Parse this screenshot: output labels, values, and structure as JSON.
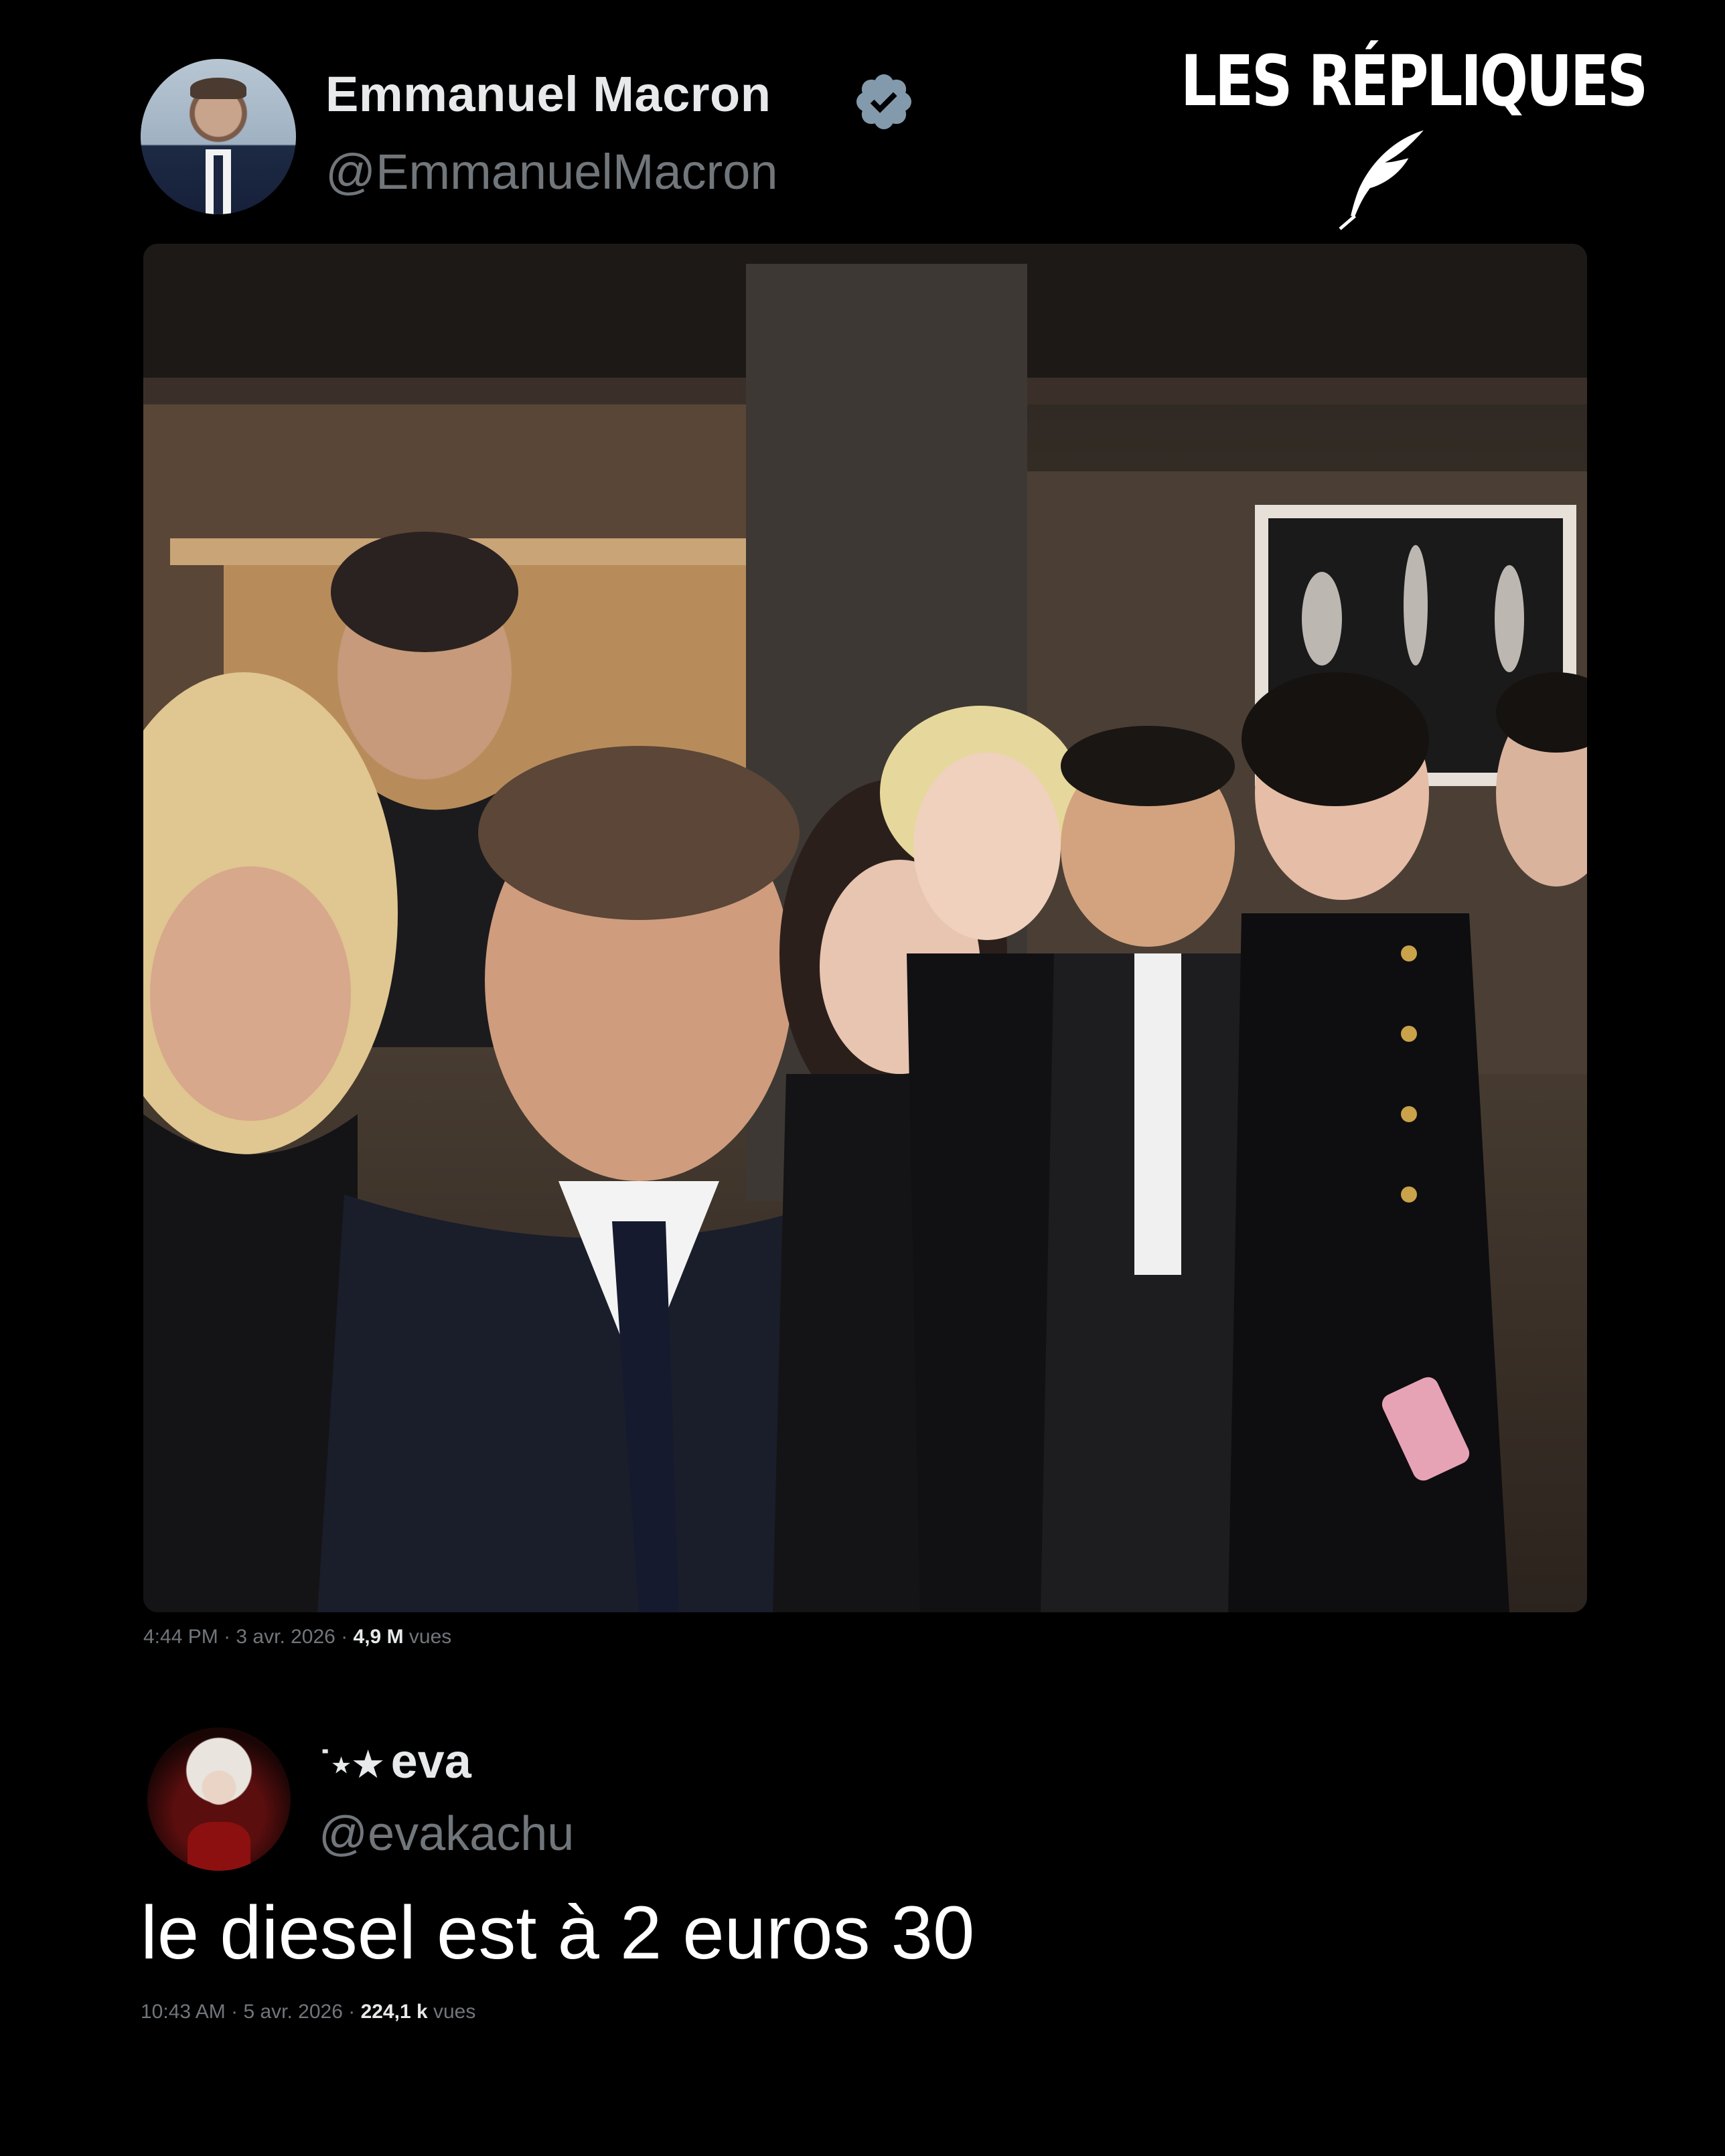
{
  "tweet": {
    "author": {
      "display_name": "Emmanuel Macron",
      "handle": "@EmmanuelMacron",
      "verified": true,
      "verified_icon": "verified-badge-icon"
    },
    "meta": {
      "time": "4:44 PM",
      "sep1": " · ",
      "date": "3 avr. 2026",
      "sep2": " · ",
      "views_count": "4,9 M",
      "views_label": " vues"
    }
  },
  "branding": {
    "title": "LES RÉPLIQUES",
    "icon": "quill-icon"
  },
  "reply": {
    "author": {
      "stars": "˙⋆★",
      "display_name": "eva",
      "handle": "@evakachu"
    },
    "text": "le diesel est à 2 euros 30",
    "meta": {
      "time": "10:43 AM",
      "sep1": " · ",
      "date": "5 avr. 2026",
      "sep2": " · ",
      "views_count": "224,1 k",
      "views_label": " vues"
    }
  },
  "colors": {
    "background": "#000000",
    "primary_text": "#e7e9ea",
    "secondary_text": "#71767b",
    "verified": "#829aab"
  }
}
